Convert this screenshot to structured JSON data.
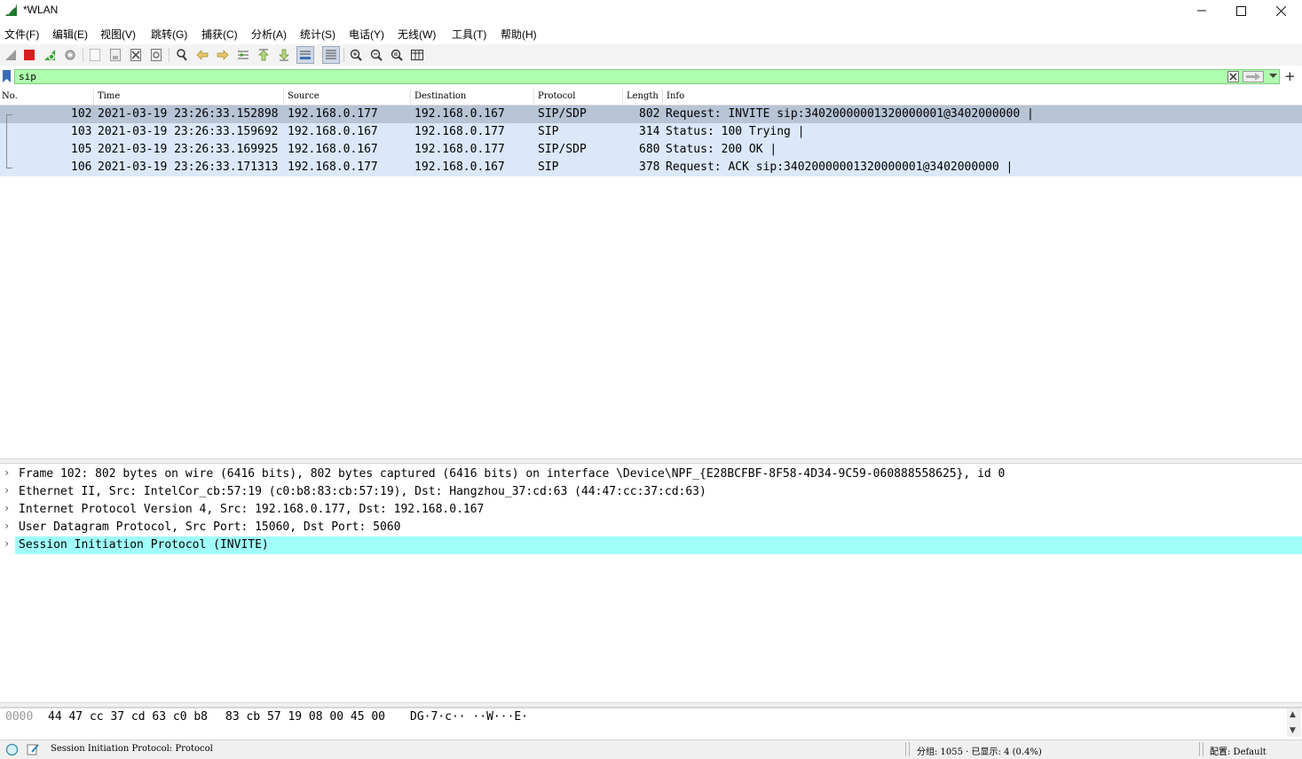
{
  "window": {
    "title": "*WLAN",
    "minimize": "—",
    "maximize": "☐",
    "close": "✕"
  },
  "menu": [
    "文件(F)",
    "编辑(E)",
    "视图(V)",
    "跳转(G)",
    "捕获(C)",
    "分析(A)",
    "统计(S)",
    "电话(Y)",
    "无线(W)",
    "工具(T)",
    "帮助(H)"
  ],
  "filter": {
    "value": "sip",
    "add_label": "+"
  },
  "columns": [
    "No.",
    "Time",
    "Source",
    "Destination",
    "Protocol",
    "Length",
    "Info"
  ],
  "packets": [
    {
      "no": "102",
      "time": "2021-03-19 23:26:33.152898",
      "src": "192.168.0.177",
      "dst": "192.168.0.167",
      "proto": "SIP/SDP",
      "len": "802",
      "info": "Request: INVITE sip:34020000001320000001@3402000000 |",
      "selected": true
    },
    {
      "no": "103",
      "time": "2021-03-19 23:26:33.159692",
      "src": "192.168.0.167",
      "dst": "192.168.0.177",
      "proto": "SIP",
      "len": "314",
      "info": "Status: 100 Trying |",
      "selected": false
    },
    {
      "no": "105",
      "time": "2021-03-19 23:26:33.169925",
      "src": "192.168.0.167",
      "dst": "192.168.0.177",
      "proto": "SIP/SDP",
      "len": "680",
      "info": "Status: 200 OK |",
      "selected": false
    },
    {
      "no": "106",
      "time": "2021-03-19 23:26:33.171313",
      "src": "192.168.0.177",
      "dst": "192.168.0.167",
      "proto": "SIP",
      "len": "378",
      "info": "Request: ACK sip:34020000001320000001@3402000000 |",
      "selected": false
    }
  ],
  "details": [
    {
      "text": "Frame 102: 802 bytes on wire (6416 bits), 802 bytes captured (6416 bits) on interface \\Device\\NPF_{E28BCFBF-8F58-4D34-9C59-060888558625}, id 0",
      "highlighted": false
    },
    {
      "text": "Ethernet II, Src: IntelCor_cb:57:19 (c0:b8:83:cb:57:19), Dst: Hangzhou_37:cd:63 (44:47:cc:37:cd:63)",
      "highlighted": false
    },
    {
      "text": "Internet Protocol Version 4, Src: 192.168.0.177, Dst: 192.168.0.167",
      "highlighted": false
    },
    {
      "text": "User Datagram Protocol, Src Port: 15060, Dst Port: 5060",
      "highlighted": false
    },
    {
      "text": "Session Initiation Protocol (INVITE)",
      "highlighted": true
    }
  ],
  "bytes": {
    "offset": "0000",
    "hex1": "44 47 cc 37 cd 63 c0 b8",
    "hex2": "83 cb 57 19 08 00 45 00",
    "ascii": "DG·7·c·· ··W···E·"
  },
  "status": {
    "field": "Session Initiation Protocol: Protocol",
    "packets": "分组: 1055 · 已显示: 4 (0.4%)",
    "profile": "配置: Default"
  },
  "colors": {
    "filter_valid": "#afffaf",
    "row_bg": "#dbe8f9",
    "row_selected": "#b6c4d6",
    "detail_highlight": "#a0fffb"
  }
}
